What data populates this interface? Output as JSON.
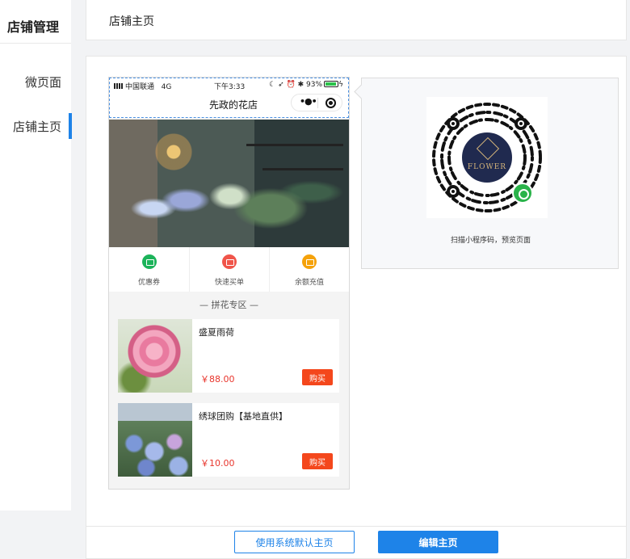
{
  "sidebar": {
    "title": "店铺管理",
    "items": [
      {
        "label": "微页面",
        "active": false
      },
      {
        "label": "店铺主页",
        "active": true
      }
    ]
  },
  "header": {
    "title": "店铺主页"
  },
  "phone": {
    "status_bar": {
      "carrier": "中国联通",
      "network": "4G",
      "time": "下午3:33",
      "battery": "93%"
    },
    "nav_title": "先政的花店",
    "capsule": {
      "more_icon": "more-dots-icon",
      "close_icon": "target-close-icon"
    },
    "quick_actions": [
      {
        "label": "优惠券",
        "icon": "coupon-icon",
        "color": "#1cb35a"
      },
      {
        "label": "快速买单",
        "icon": "wallet-icon",
        "color": "#f0554a"
      },
      {
        "label": "余额充值",
        "icon": "yen-icon",
        "color": "#f5a20a"
      }
    ],
    "section_title": "— 拼花专区 —",
    "products": [
      {
        "name": "盛夏雨荷",
        "price": "￥88.00",
        "buy_label": "购买"
      },
      {
        "name": "绣球团购【基地直供】",
        "price": "￥10.00",
        "buy_label": "购买"
      }
    ]
  },
  "qr": {
    "logo_text": "FLOWER",
    "caption": "扫描小程序码，预览页面"
  },
  "footer": {
    "default_button": "使用系统默认主页",
    "edit_button": "编辑主页"
  },
  "colors": {
    "accent": "#1e83e8",
    "buy": "#f4471c",
    "price": "#e8352c"
  }
}
